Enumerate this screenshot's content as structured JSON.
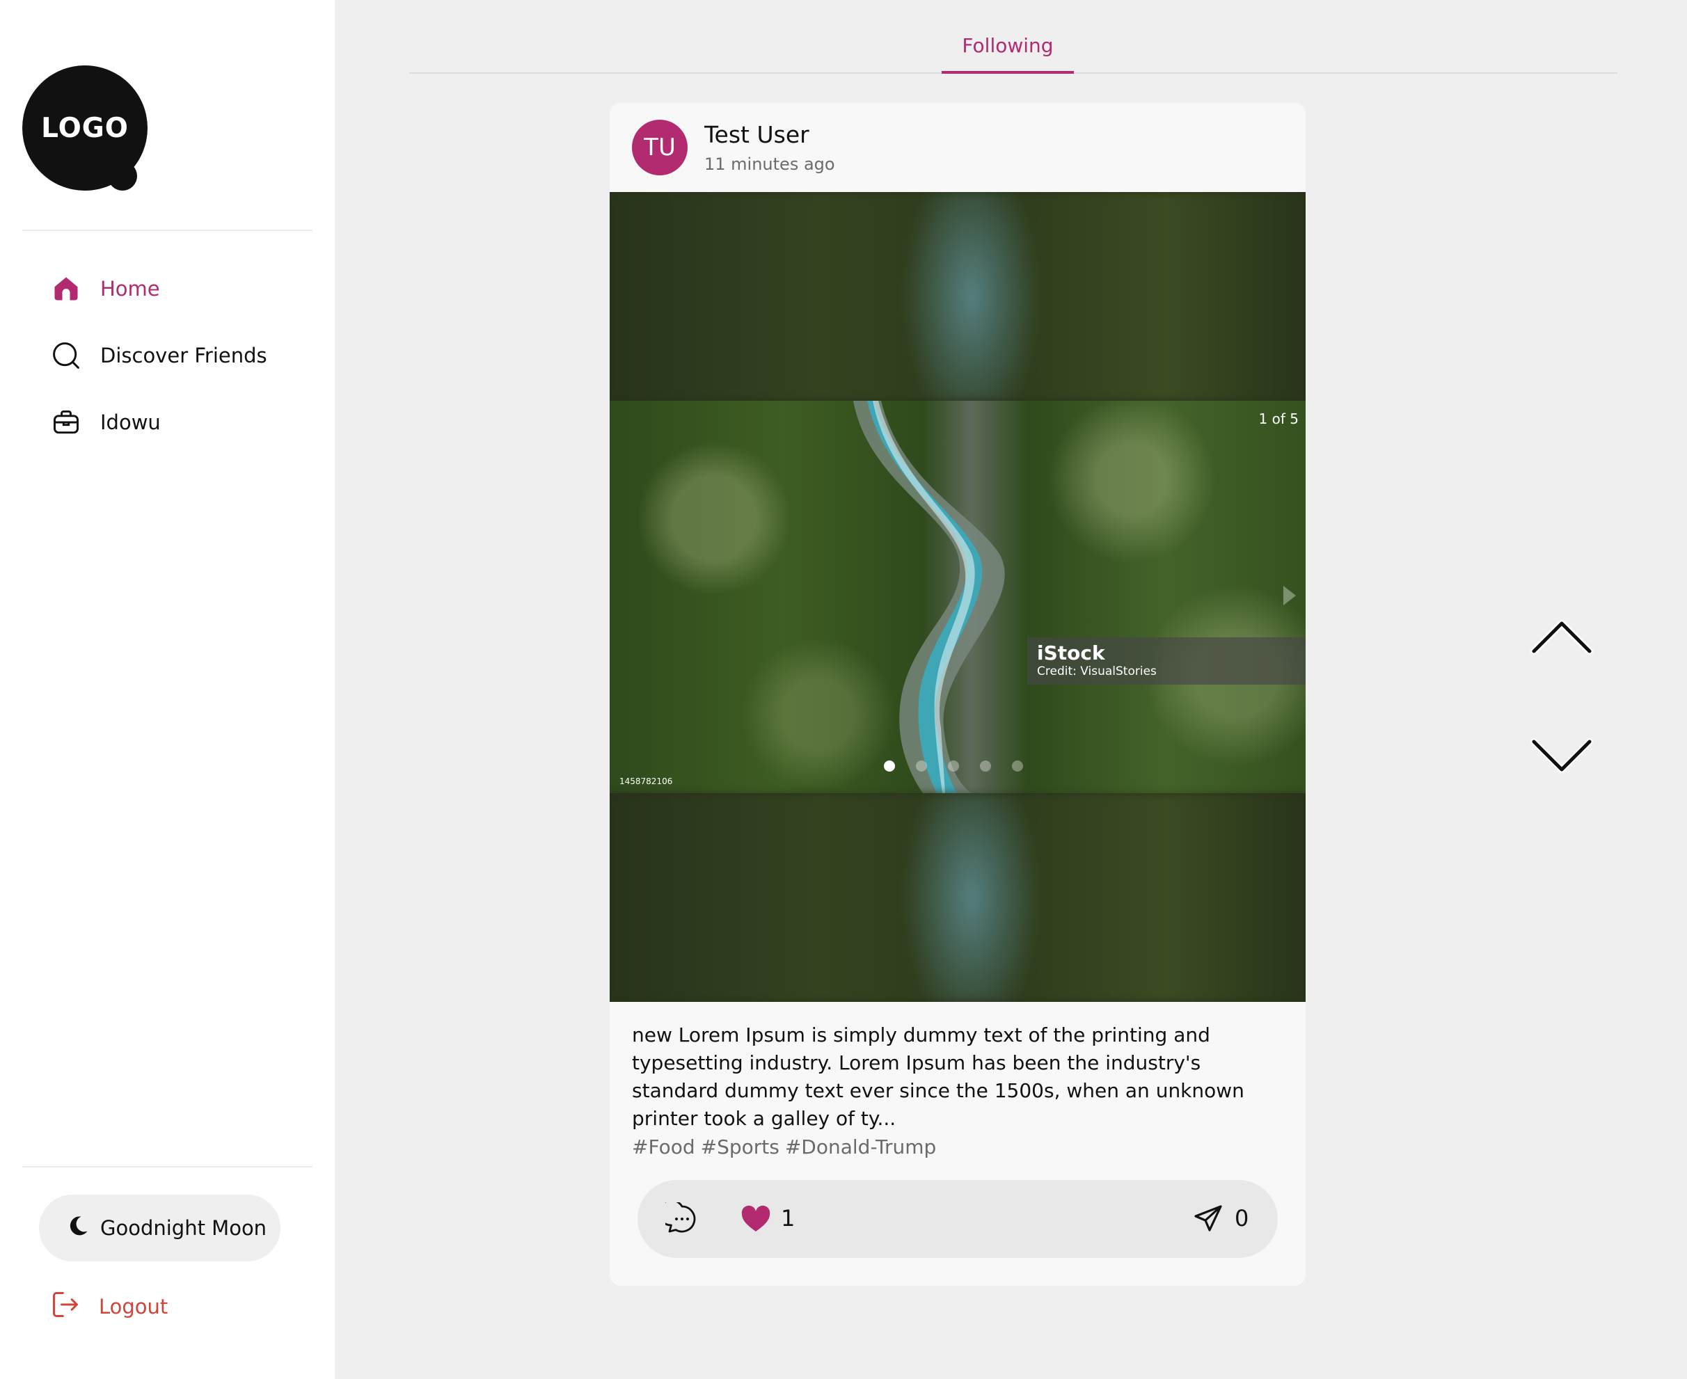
{
  "brand": {
    "logo_text": "LOGO",
    "accent": "#b22a70",
    "logout_color": "#d0453a"
  },
  "sidebar": {
    "items": [
      {
        "label": "Home",
        "icon": "home-icon",
        "active": true
      },
      {
        "label": "Discover Friends",
        "icon": "search-icon",
        "active": false
      },
      {
        "label": "Idowu",
        "icon": "briefcase-icon",
        "active": false
      }
    ],
    "theme_toggle": {
      "label": "Goodnight Moon",
      "icon": "moon-icon"
    },
    "logout": {
      "label": "Logout",
      "icon": "logout-icon"
    }
  },
  "tabs": [
    {
      "label": "Following",
      "active": true
    }
  ],
  "post": {
    "author": {
      "name": "Test User",
      "initials": "TU"
    },
    "time": "11 minutes ago",
    "media": {
      "slide_counter": "1 of 5",
      "total_slides": 5,
      "current_slide": 1,
      "watermark_logo": "iStock",
      "watermark_credit": "Credit: VisualStories",
      "image_id": "1458782106"
    },
    "caption": "new Lorem Ipsum is simply dummy text of the printing and typesetting industry. Lorem Ipsum has been the industry's standard dummy text ever since the 1500s, when an unknown printer took a galley of ty...",
    "hashtags": [
      "#Food",
      "#Sports",
      "#Donald-Trump"
    ],
    "likes": "1",
    "shares": "0"
  },
  "navigation": {
    "up_icon": "chevron-up-icon",
    "down_icon": "chevron-down-icon"
  }
}
